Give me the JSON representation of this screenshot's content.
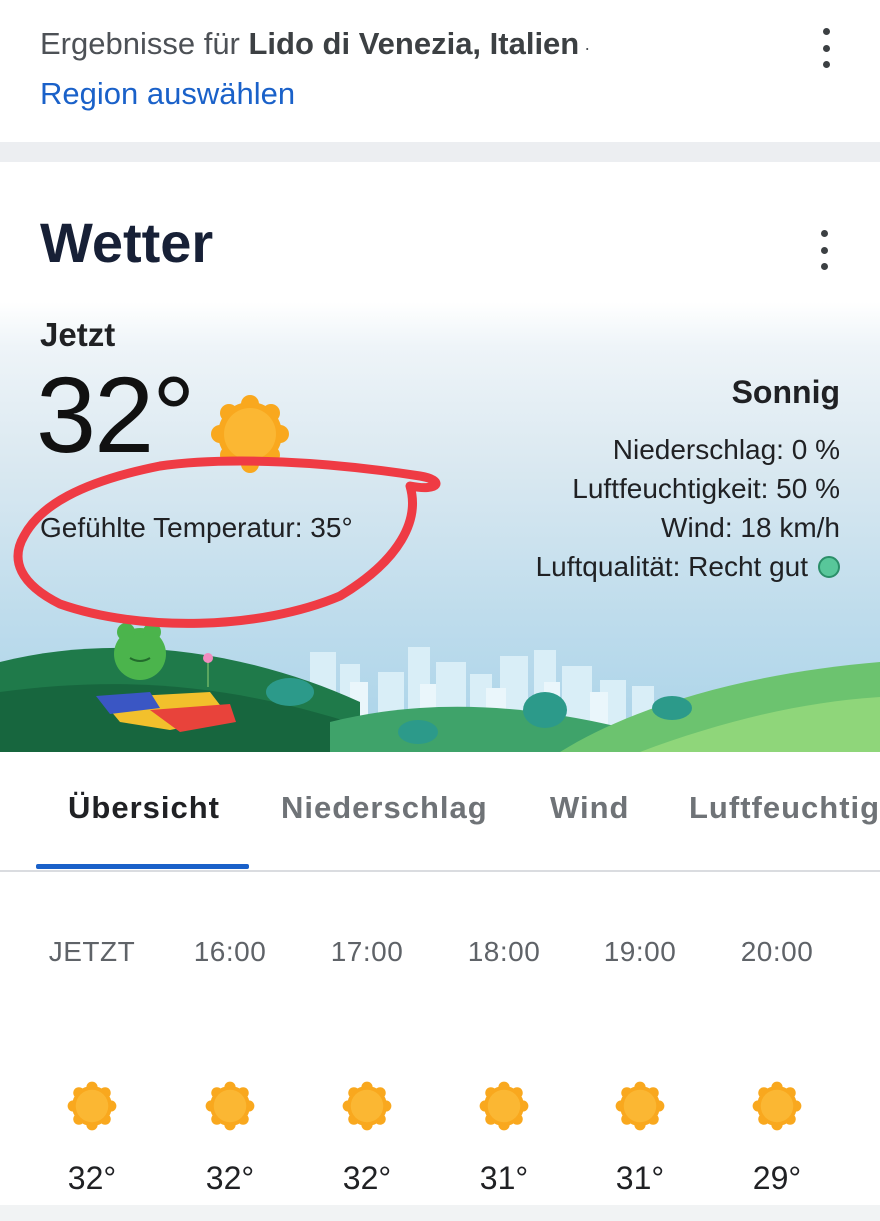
{
  "results": {
    "prefix": "Ergebnisse für ",
    "location": "Lido di Venezia, Italien",
    "suffix": " ·",
    "region_link": "Region auswählen"
  },
  "card": {
    "title": "Wetter"
  },
  "current": {
    "label": "Jetzt",
    "temperature": "32°",
    "feels_like": "Gefühlte Temperatur: 35°",
    "condition": "Sonnig",
    "precipitation": "Niederschlag: 0 %",
    "humidity": "Luftfeuchtigkeit: 50 %",
    "wind": "Wind: 18 km/h",
    "air_quality": "Luftqualität: Recht gut",
    "air_quality_color": "#58c79a",
    "icon": "sunny-icon"
  },
  "tabs": [
    {
      "label": "Übersicht",
      "active": true
    },
    {
      "label": "Niederschlag",
      "active": false
    },
    {
      "label": "Wind",
      "active": false
    },
    {
      "label": "Luftfeuchtig",
      "active": false
    }
  ],
  "hourly": [
    {
      "time": "JETZT",
      "temp": "32°",
      "icon": "sunny-icon"
    },
    {
      "time": "16:00",
      "temp": "32°",
      "icon": "sunny-icon"
    },
    {
      "time": "17:00",
      "temp": "32°",
      "icon": "sunny-icon"
    },
    {
      "time": "18:00",
      "temp": "31°",
      "icon": "sunny-icon"
    },
    {
      "time": "19:00",
      "temp": "31°",
      "icon": "sunny-icon"
    },
    {
      "time": "20:00",
      "temp": "29°",
      "icon": "sunny-icon"
    }
  ],
  "colors": {
    "accent": "#1a61c9",
    "annotation": "#ef3b44",
    "sun": "#f9a81e"
  }
}
